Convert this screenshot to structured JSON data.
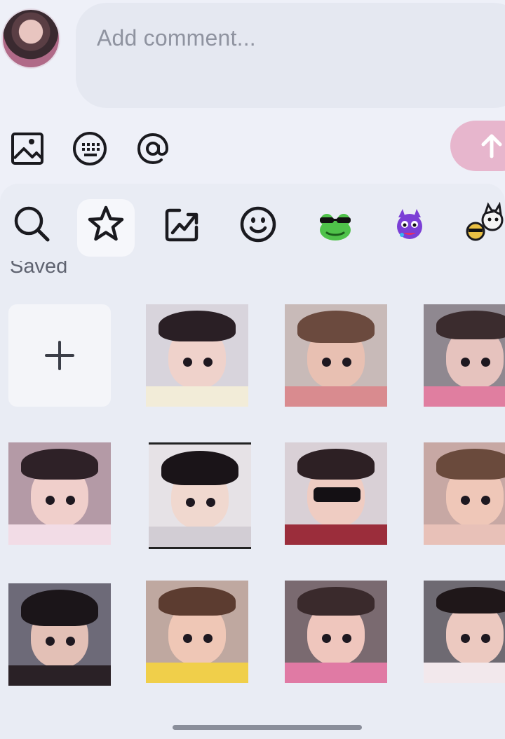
{
  "comment": {
    "placeholder": "Add comment..."
  },
  "toolbar": {
    "icons": [
      "image-icon",
      "keyboard-icon",
      "mention-icon"
    ],
    "send_icon": "arrow-up-icon"
  },
  "sticker_panel": {
    "tabs": [
      {
        "icon": "search-icon",
        "selected": false
      },
      {
        "icon": "star-icon",
        "selected": true
      },
      {
        "icon": "trending-icon",
        "selected": false
      },
      {
        "icon": "smiley-icon",
        "selected": false
      },
      {
        "icon": "frog-sticker-icon",
        "selected": false
      },
      {
        "icon": "purple-monster-sticker-icon",
        "selected": false
      },
      {
        "icon": "cartoon-dogs-sticker-icon",
        "selected": false
      }
    ],
    "section_label": "Saved",
    "add_tile_icon": "plus-icon",
    "saved_items_count": 11
  },
  "colors": {
    "background": "#eef0f8",
    "input_fill": "#e5e8f1",
    "send_button": "#e7b6cd",
    "icon_stroke": "#1a1a1f"
  }
}
